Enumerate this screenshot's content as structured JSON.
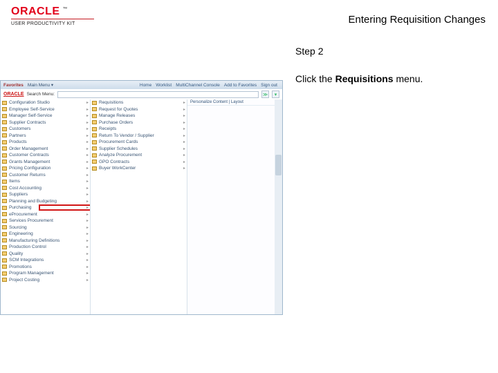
{
  "header": {
    "brand": "ORACLE",
    "tm": "™",
    "upk": "USER PRODUCTIVITY KIT",
    "title": "Entering Requisition Changes"
  },
  "side": {
    "step": "Step 2",
    "instr_pre": "Click the ",
    "instr_bold": "Requisitions",
    "instr_post": " menu."
  },
  "app": {
    "favorites": "Favorites",
    "mainmenu": "Main Menu ▾",
    "toplinks": [
      "Home",
      "Worklist",
      "MultiChannel Console",
      "Add to Favorites",
      "Sign out"
    ],
    "brand": "ORACLE",
    "search_label": "Search Menu:",
    "breadcrumb": "Personalize Content | Layout",
    "menu": [
      "Configuration Studio",
      "Employee Self-Service",
      "Manager Self-Service",
      "Supplier Contracts",
      "Customers",
      "Partners",
      "Products",
      "Order Management",
      "Customer Contracts",
      "Grants Management",
      "Pricing Configuration",
      "Customer Returns",
      "Items",
      "Cost Accounting",
      "Suppliers",
      "Planning and Budgeting"
    ],
    "highlighted": "Purchasing",
    "menu_after": [
      "eProcurement",
      "Services Procurement",
      "Sourcing",
      "Engineering",
      "Manufacturing Definitions",
      "Production Control",
      "Quality",
      "SCM Integrations",
      "Promotions",
      "Program Management",
      "Project Costing"
    ],
    "submenu": [
      "Requisitions",
      "Request for Quotes",
      "Manage Releases",
      "Purchase Orders",
      "Receipts",
      "Return To Vendor / Supplier",
      "Procurement Cards",
      "Supplier Schedules",
      "Analyze Procurement",
      "GPO Contracts",
      "Buyer WorkCenter"
    ]
  }
}
